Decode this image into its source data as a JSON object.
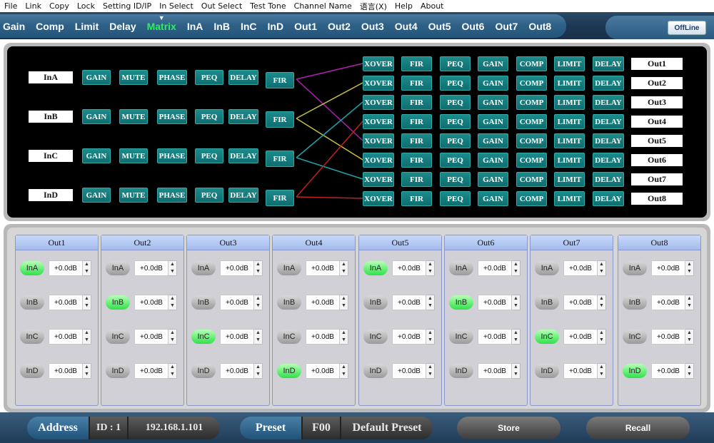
{
  "menu": [
    "File",
    "Link",
    "Copy",
    "Lock",
    "Setting ID/IP",
    "In Select",
    "Out Select",
    "Test Tone",
    "Channel Name",
    "语言(X)",
    "Help",
    "About"
  ],
  "tabs": [
    "Gain",
    "Comp",
    "Limit",
    "Delay",
    "Matrix",
    "InA",
    "InB",
    "InC",
    "InD",
    "Out1",
    "Out2",
    "Out3",
    "Out4",
    "Out5",
    "Out6",
    "Out7",
    "Out8"
  ],
  "active_tab": "Matrix",
  "status": "OffLine",
  "routing": {
    "inputs": [
      "InA",
      "InB",
      "InC",
      "InD"
    ],
    "input_chain": [
      "GAIN",
      "MUTE",
      "PHASE",
      "PEQ",
      "DELAY",
      "FIR"
    ],
    "output_chain": [
      "XOVER",
      "FIR",
      "PEQ",
      "GAIN",
      "COMP",
      "LIMIT",
      "DELAY"
    ],
    "outputs": [
      "Out1",
      "Out2",
      "Out3",
      "Out4",
      "Out5",
      "Out6",
      "Out7",
      "Out8"
    ],
    "connections": [
      {
        "input": "InA",
        "outputs": [
          "Out1",
          "Out5"
        ],
        "color": "#b020b0"
      },
      {
        "input": "InB",
        "outputs": [
          "Out2",
          "Out6"
        ],
        "color": "#c8c040"
      },
      {
        "input": "InC",
        "outputs": [
          "Out3",
          "Out7"
        ],
        "color": "#20a0a8"
      },
      {
        "input": "InD",
        "outputs": [
          "Out4",
          "Out8"
        ],
        "color": "#c02020"
      }
    ]
  },
  "mixer": {
    "channels": [
      {
        "name": "Out1",
        "rows": [
          {
            "input": "InA",
            "on": true,
            "gain": "+0.0dB"
          },
          {
            "input": "InB",
            "on": false,
            "gain": "+0.0dB"
          },
          {
            "input": "InC",
            "on": false,
            "gain": "+0.0dB"
          },
          {
            "input": "InD",
            "on": false,
            "gain": "+0.0dB"
          }
        ]
      },
      {
        "name": "Out2",
        "rows": [
          {
            "input": "InA",
            "on": false,
            "gain": "+0.0dB"
          },
          {
            "input": "InB",
            "on": true,
            "gain": "+0.0dB"
          },
          {
            "input": "InC",
            "on": false,
            "gain": "+0.0dB"
          },
          {
            "input": "InD",
            "on": false,
            "gain": "+0.0dB"
          }
        ]
      },
      {
        "name": "Out3",
        "rows": [
          {
            "input": "InA",
            "on": false,
            "gain": "+0.0dB"
          },
          {
            "input": "InB",
            "on": false,
            "gain": "+0.0dB"
          },
          {
            "input": "InC",
            "on": true,
            "gain": "+0.0dB"
          },
          {
            "input": "InD",
            "on": false,
            "gain": "+0.0dB"
          }
        ]
      },
      {
        "name": "Out4",
        "rows": [
          {
            "input": "InA",
            "on": false,
            "gain": "+0.0dB"
          },
          {
            "input": "InB",
            "on": false,
            "gain": "+0.0dB"
          },
          {
            "input": "InC",
            "on": false,
            "gain": "+0.0dB"
          },
          {
            "input": "InD",
            "on": true,
            "gain": "+0.0dB"
          }
        ]
      },
      {
        "name": "Out5",
        "rows": [
          {
            "input": "InA",
            "on": true,
            "gain": "+0.0dB"
          },
          {
            "input": "InB",
            "on": false,
            "gain": "+0.0dB"
          },
          {
            "input": "InC",
            "on": false,
            "gain": "+0.0dB"
          },
          {
            "input": "InD",
            "on": false,
            "gain": "+0.0dB"
          }
        ]
      },
      {
        "name": "Out6",
        "rows": [
          {
            "input": "InA",
            "on": false,
            "gain": "+0.0dB"
          },
          {
            "input": "InB",
            "on": true,
            "gain": "+0.0dB"
          },
          {
            "input": "InC",
            "on": false,
            "gain": "+0.0dB"
          },
          {
            "input": "InD",
            "on": false,
            "gain": "+0.0dB"
          }
        ]
      },
      {
        "name": "Out7",
        "rows": [
          {
            "input": "InA",
            "on": false,
            "gain": "+0.0dB"
          },
          {
            "input": "InB",
            "on": false,
            "gain": "+0.0dB"
          },
          {
            "input": "InC",
            "on": true,
            "gain": "+0.0dB"
          },
          {
            "input": "InD",
            "on": false,
            "gain": "+0.0dB"
          }
        ]
      },
      {
        "name": "Out8",
        "rows": [
          {
            "input": "InA",
            "on": false,
            "gain": "+0.0dB"
          },
          {
            "input": "InB",
            "on": false,
            "gain": "+0.0dB"
          },
          {
            "input": "InC",
            "on": false,
            "gain": "+0.0dB"
          },
          {
            "input": "InD",
            "on": true,
            "gain": "+0.0dB"
          }
        ]
      }
    ]
  },
  "bottom": {
    "address_label": "Address",
    "id": "ID : 1",
    "ip": "192.168.1.101",
    "preset_label": "Preset",
    "preset_num": "F00",
    "preset_name": "Default Preset",
    "store": "Store",
    "recall": "Recall"
  },
  "colors": {
    "active_tab": "#2cf05a",
    "on_pill": "#2ee24a",
    "block": "#0f6e70"
  }
}
